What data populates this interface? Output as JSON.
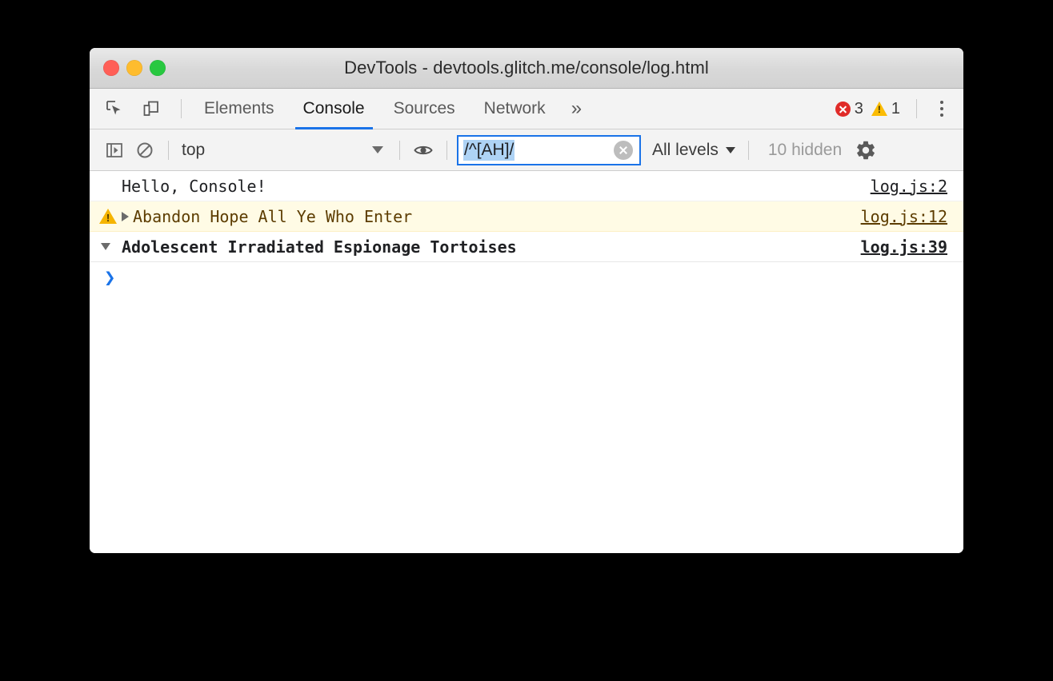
{
  "window": {
    "title": "DevTools - devtools.glitch.me/console/log.html",
    "traffic_lights": [
      "close-red",
      "minimize-yellow",
      "zoom-green"
    ]
  },
  "tabbar": {
    "inspect_icon": "inspect-element-icon",
    "device_icon": "device-toolbar-icon",
    "tabs": [
      {
        "label": "Elements",
        "active": false
      },
      {
        "label": "Console",
        "active": true
      },
      {
        "label": "Sources",
        "active": false
      },
      {
        "label": "Network",
        "active": false
      }
    ],
    "more_tabs_label": "»",
    "error_count": "3",
    "warning_count": "1",
    "menu_icon": "kebab-menu-icon"
  },
  "console_toolbar": {
    "sidebar_icon": "console-sidebar-toggle-icon",
    "clear_icon": "clear-console-icon",
    "context_value": "top",
    "context_options": [
      "top"
    ],
    "live_expression_icon": "eye-icon",
    "filter_value": "/^[AH]/",
    "filter_placeholder": "Filter",
    "filter_clear_icon": "clear-filter-icon",
    "levels_label": "All levels",
    "hidden_label": "10 hidden",
    "settings_icon": "gear-icon"
  },
  "messages": [
    {
      "text": "Hello, Console!",
      "source": "log.js:2",
      "level": "log",
      "expandable": false,
      "group": false
    },
    {
      "text": "Abandon Hope All Ye Who Enter",
      "source": "log.js:12",
      "level": "warning",
      "expandable": true,
      "group": false
    },
    {
      "text": "Adolescent Irradiated Espionage Tortoises",
      "source": "log.js:39",
      "level": "log",
      "expandable": false,
      "group": true
    }
  ],
  "prompt": {
    "caret": "❯"
  },
  "colors": {
    "accent": "#1a73e8",
    "warning_bg": "#fffbe5",
    "warning_text": "#5c3c00",
    "error_red": "#e02b28",
    "warning_yellow": "#fbbc04"
  }
}
